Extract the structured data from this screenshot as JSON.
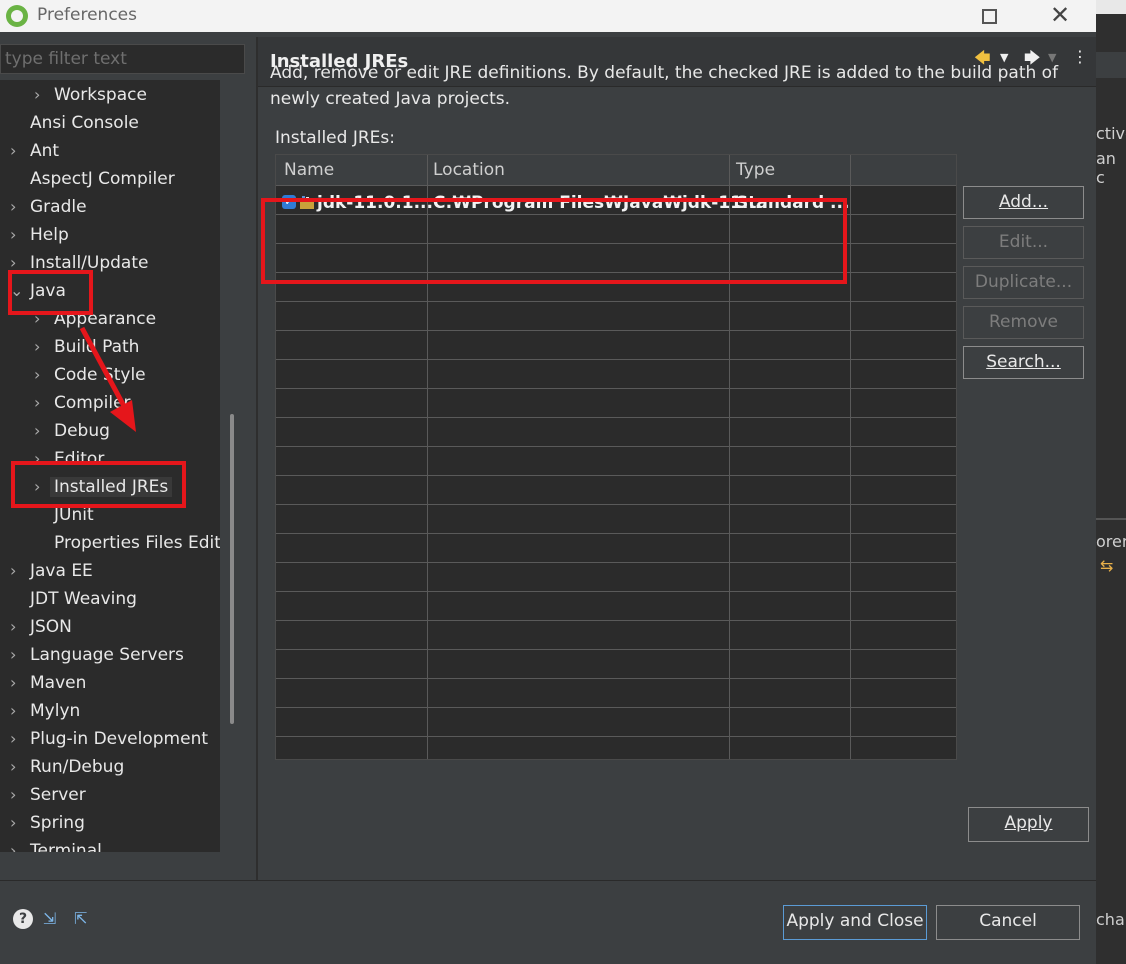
{
  "window": {
    "title": "Preferences"
  },
  "filter": {
    "placeholder": "type filter text"
  },
  "tree": [
    {
      "label": "Workspace",
      "chev": "›",
      "indent": 1
    },
    {
      "label": "Ansi Console",
      "chev": "",
      "indent": 0
    },
    {
      "label": "Ant",
      "chev": "›",
      "indent": 0
    },
    {
      "label": "AspectJ Compiler",
      "chev": "",
      "indent": 0
    },
    {
      "label": "Gradle",
      "chev": "›",
      "indent": 0
    },
    {
      "label": "Help",
      "chev": "›",
      "indent": 0
    },
    {
      "label": "Install/Update",
      "chev": "›",
      "indent": 0
    },
    {
      "label": "Java",
      "chev": "⌄",
      "indent": 0
    },
    {
      "label": "Appearance",
      "chev": "›",
      "indent": 1
    },
    {
      "label": "Build Path",
      "chev": "›",
      "indent": 1
    },
    {
      "label": "Code Style",
      "chev": "›",
      "indent": 1
    },
    {
      "label": "Compiler",
      "chev": "›",
      "indent": 1
    },
    {
      "label": "Debug",
      "chev": "›",
      "indent": 1
    },
    {
      "label": "Editor",
      "chev": "›",
      "indent": 1
    },
    {
      "label": "Installed JREs",
      "chev": "›",
      "indent": 1,
      "selected": true
    },
    {
      "label": "JUnit",
      "chev": "",
      "indent": 1
    },
    {
      "label": "Properties Files Editor",
      "chev": "",
      "indent": 1
    },
    {
      "label": "Java EE",
      "chev": "›",
      "indent": 0
    },
    {
      "label": "JDT Weaving",
      "chev": "",
      "indent": 0
    },
    {
      "label": "JSON",
      "chev": "›",
      "indent": 0
    },
    {
      "label": "Language Servers",
      "chev": "›",
      "indent": 0
    },
    {
      "label": "Maven",
      "chev": "›",
      "indent": 0
    },
    {
      "label": "Mylyn",
      "chev": "›",
      "indent": 0
    },
    {
      "label": "Plug-in Development",
      "chev": "›",
      "indent": 0
    },
    {
      "label": "Run/Debug",
      "chev": "›",
      "indent": 0
    },
    {
      "label": "Server",
      "chev": "›",
      "indent": 0
    },
    {
      "label": "Spring",
      "chev": "›",
      "indent": 0
    },
    {
      "label": "Terminal",
      "chev": "›",
      "indent": 0
    }
  ],
  "page": {
    "title": "Installed JREs",
    "description": "Add, remove or edit JRE definitions. By default, the checked JRE is added to the build path of newly created Java projects.",
    "list_label": "Installed JREs:"
  },
  "table": {
    "columns": [
      "Name",
      "Location",
      "Type"
    ],
    "rows": [
      {
        "name": "jdk-11.0.1...",
        "location": "C:₩Program Files₩Java₩jdk-11....",
        "type": "Standard ...",
        "checked": true
      }
    ]
  },
  "buttons": {
    "add": "Add...",
    "edit": "Edit...",
    "duplicate": "Duplicate...",
    "remove": "Remove",
    "search": "Search...",
    "apply": "Apply",
    "apply_close": "Apply and Close",
    "cancel": "Cancel"
  },
  "background_ide": {
    "t1": "ctive",
    "t2": "an c",
    "t3": "orer",
    "t5": "char"
  },
  "colors": {
    "annotation": "#e5161b",
    "accent": "#2f7bd6"
  }
}
